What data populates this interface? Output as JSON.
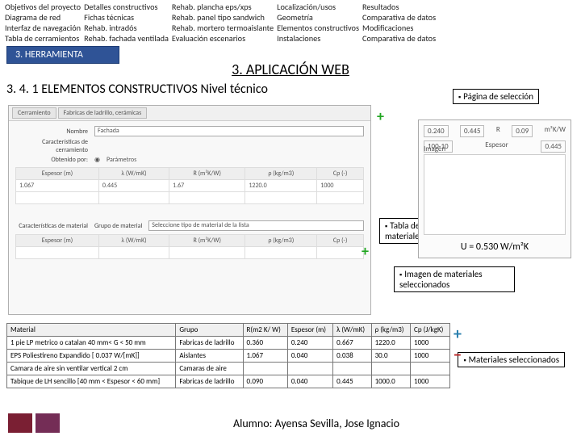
{
  "nav": {
    "c1": [
      "Objetivos del proyecto",
      "Diagrama de red",
      "Interfaz de navegación",
      "Tabla de cerramientos"
    ],
    "c2": [
      "Detalles constructivos",
      "Fichas técnicas",
      "Rehab. intradós",
      "Rehab. fachada ventilada"
    ],
    "c3": [
      "Rehab. plancha eps/xps",
      "Rehab. panel tipo sandwich",
      "Rehab. mortero termoaislante",
      "Evaluación escenarios"
    ],
    "c4": [
      "Localización/usos",
      "Geometría",
      "Elementos constructivos",
      "Instalaciones"
    ],
    "c5": [
      "Resultados",
      "Comparativa de datos",
      "Modificaciones",
      "Comparativa de datos"
    ]
  },
  "tool_tab": "3. HERRAMIENTA",
  "app_title": "3. APLICACIÓN WEB",
  "subtitle": "3. 4. 1 ELEMENTOS CONSTRUCTIVOS Nivel técnico",
  "callouts": {
    "c1": "Página de selección",
    "c2": "Tabla de introducción de materiales",
    "c3": "Imagen de materiales seleccionados",
    "c4": "Materiales seleccionados"
  },
  "scr": {
    "tabs": [
      "Cerramiento",
      "Fabricas de ladrillo, cerámicas"
    ],
    "labels": {
      "nombre": "Nombre",
      "carac": "Características de cerramiento",
      "obt": "Obtenido por:",
      "caracm": "Características de material",
      "grupo": "Grupo de material",
      "sel": "Seleccione tipo de material de la lista"
    },
    "name_value": "Fachada",
    "radio": "Parámetros"
  },
  "uval": {
    "t_left": "0.240",
    "unit_left": "—",
    "t_right": "0.445",
    "r_label": "R",
    "r_val": "0.09",
    "r_unit": "m²K/W",
    "row2_a": "100-10",
    "row2_b": "Espesor",
    "row2_c": "0.445",
    "img_label": "Imagen",
    "u": "U = 0.530 W/m²K"
  },
  "inner_table": {
    "headers": [
      "Espesor (m)",
      "λ (W/mK)",
      "R (m²K/W)",
      "ρ (kg/m3)",
      "Cp (-)"
    ],
    "values": [
      "1.067",
      "0.445",
      "1.67",
      "1220.0",
      "1000"
    ]
  },
  "mat_table": {
    "headers": [
      "Material",
      "Grupo",
      "R(m2 K/ W)",
      "Espesor (m)",
      "λ (W/mK)",
      "ρ (kg/m3)",
      "Cp (J/kgK)"
    ],
    "rows": [
      [
        "1 pie LP metrico o catalan 40 mm< G < 50 mm",
        "Fabricas de ladrillo",
        "0.360",
        "0.240",
        "0.667",
        "1220.0",
        "1000"
      ],
      [
        "EPS Poliestireno Expandido [ 0.037 W/[mK]]",
        "Aislantes",
        "1.067",
        "0.040",
        "0.038",
        "30.0",
        "1000"
      ],
      [
        "Camara de aire sin ventilar vertical 2 cm",
        "Camaras de aire",
        "",
        "",
        "",
        "",
        ""
      ],
      [
        "Tabique de LH sencillo [40 mm < Espesor < 60 mm]",
        "Fabricas de ladrillo",
        "0.090",
        "0.040",
        "0.445",
        "1000.0",
        "1000"
      ]
    ]
  },
  "footer": {
    "name": "Alumno: Ayensa Sevilla, Jose Ignacio"
  }
}
